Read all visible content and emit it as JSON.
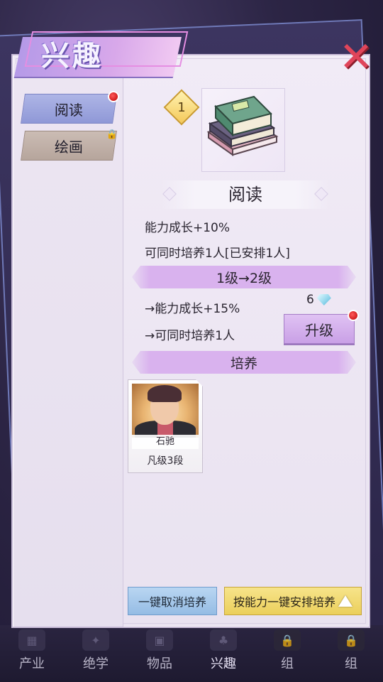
{
  "title": "兴趣",
  "sidebar": {
    "items": [
      {
        "label": "阅读",
        "has_notification": true,
        "locked": false
      },
      {
        "label": "绘画",
        "has_notification": false,
        "locked": true
      }
    ]
  },
  "hobby": {
    "level": "1",
    "icon": "books-icon",
    "name": "阅读",
    "current_effects": [
      "能力成长+10%",
      "可同时培养1人[已安排1人]"
    ],
    "upgrade_header": "1级→2级",
    "next_effects": [
      "→能力成长+15%",
      "→可同时培养1人"
    ],
    "upgrade_cost": "6",
    "upgrade_cost_icon": "diamond-gem-icon",
    "upgrade_button": "升级"
  },
  "training": {
    "header": "培养",
    "characters": [
      {
        "name": "石驰",
        "rank": "凡级3段"
      }
    ]
  },
  "actions": {
    "cancel_all": "一键取消培养",
    "auto_assign": "按能力一键安排培养"
  },
  "tabbar": {
    "items": [
      {
        "label": "产业",
        "locked": false
      },
      {
        "label": "绝学",
        "locked": false
      },
      {
        "label": "物品",
        "locked": false
      },
      {
        "label": "兴趣",
        "locked": false,
        "active": true
      },
      {
        "label": "组",
        "locked": true
      },
      {
        "label": "组",
        "locked": true
      }
    ]
  },
  "colors": {
    "accent_purple": "#d9b2ee",
    "notification_red": "#d01c1c",
    "close_red": "#e0455a",
    "level_gold": "#f4c95a"
  }
}
